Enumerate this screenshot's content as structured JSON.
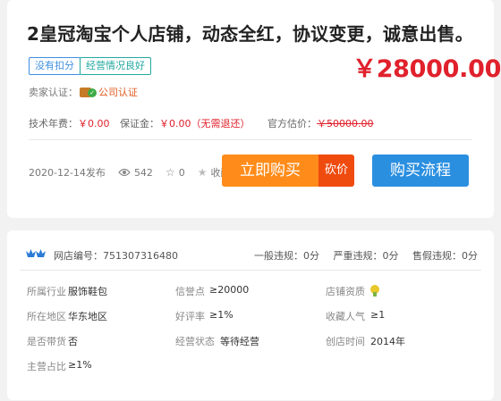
{
  "listing": {
    "title": "2皇冠淘宝个人店铺，动态全红，协议变更，诚意出售。",
    "tags": [
      "没有扣分",
      "经营情况良好"
    ],
    "price": "￥28000.00",
    "seller_cert_label": "卖家认证：",
    "seller_cert_value": "公司认证",
    "fees": {
      "tech_fee_label": "技术年费：",
      "tech_fee_value": "￥0.00",
      "deposit_label": "保证金：",
      "deposit_value": "￥0.00（无需退还）",
      "official_label": "官方估价：",
      "official_value": "￥50000.00"
    },
    "date": "2020-12-14发布",
    "views": "542",
    "stars": "0",
    "favorite_label": "收藏",
    "buy_label": "立即购买",
    "bargain_label": "砍价",
    "process_label": "购买流程"
  },
  "shop": {
    "shop_no": "网店编号：751307316480",
    "violations": [
      "一般违规：0分",
      "严重违规：0分",
      "售假违规：0分"
    ],
    "details": [
      {
        "key": "所属行业",
        "value": "服饰鞋包"
      },
      {
        "key": "信誉点",
        "value": "≥20000"
      },
      {
        "key": "店铺资质",
        "value": ""
      },
      {
        "key": "所在地区",
        "value": "华东地区"
      },
      {
        "key": "好评率",
        "value": "≥1%"
      },
      {
        "key": "收藏人气",
        "value": "≥1"
      },
      {
        "key": "是否带货",
        "value": "否"
      },
      {
        "key": "经营状态",
        "value": "等待经营"
      },
      {
        "key": "创店时间",
        "value": "2014年"
      },
      {
        "key": "主营占比",
        "value": "≥1%"
      }
    ]
  },
  "colors": {
    "price_red": "#e0212c",
    "buy_orange": "#ff8c1a",
    "bargain_red": "#ef4b0f",
    "process_blue": "#2b8fe0"
  },
  "icons": [
    "verified-company-icon",
    "eye-icon",
    "star-outline-icon",
    "star-filled-icon",
    "crown-icon",
    "shop-qualification-icon"
  ]
}
